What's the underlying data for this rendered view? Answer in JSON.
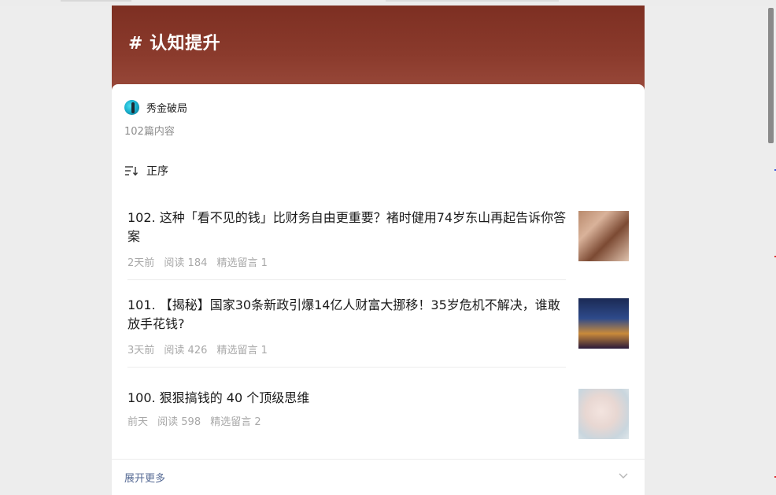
{
  "topic": {
    "title": "# 认知提升"
  },
  "author": {
    "name": "秀金破局",
    "avatar_icon": "avatar-icon"
  },
  "collection": {
    "count_text": "102篇内容"
  },
  "sort": {
    "label": "正序",
    "icon": "sort-icon"
  },
  "articles": [
    {
      "title": "102. 这种「看不见的钱」比财务自由更重要？褚时健用74岁东山再起告诉你答案",
      "time": "2天前",
      "reads": "阅读 184",
      "comments": "精选留言 1",
      "thumb": "money-photo"
    },
    {
      "title": "101. 【揭秘】国家30条新政引爆14亿人财富大挪移！35岁危机不解决，谁敢放手花钱?",
      "time": "3天前",
      "reads": "阅读 426",
      "comments": "精选留言 1",
      "thumb": "city-night-photo"
    },
    {
      "title": "100. 狠狠搞钱的 40 个顶级思维",
      "time": "前天",
      "reads": "阅读 598",
      "comments": "精选留言 2",
      "thumb": "elder-face-photo"
    }
  ],
  "footer": {
    "more_label": "展开更多",
    "icon": "chevron-down-icon"
  },
  "colors": {
    "header": "#7d2f22",
    "link": "#576b95",
    "meta": "#a8a8a8"
  }
}
